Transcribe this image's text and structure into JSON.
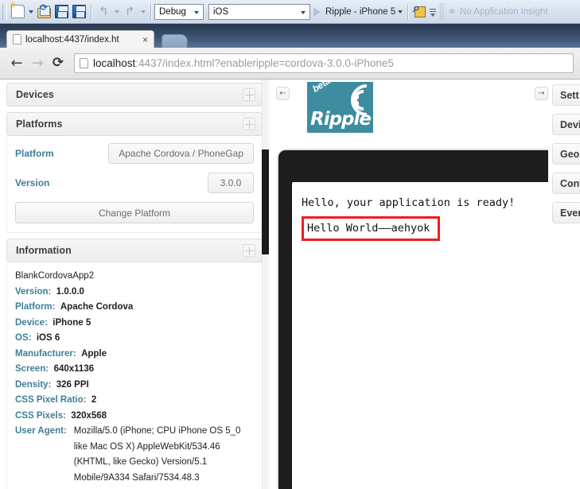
{
  "vs_toolbar": {
    "icons": [
      {
        "name": "new-item-icon",
        "title": "Add New Item"
      },
      {
        "name": "open-file-icon",
        "title": "Open File"
      },
      {
        "name": "save-icon",
        "title": "Save"
      },
      {
        "name": "save-all-icon",
        "title": "Save All"
      },
      {
        "name": "undo-icon",
        "glyph": "↰"
      },
      {
        "name": "redo-icon",
        "glyph": "↱"
      }
    ],
    "config_combo": {
      "value": "Debug"
    },
    "platform_combo": {
      "value": "iOS"
    },
    "run_target": "Ripple - iPhone 5",
    "find_icon": "find-icon",
    "insight_text": "No Application Insight"
  },
  "browser": {
    "tab": {
      "title": "localhost:4437/index.ht",
      "close_label": "×"
    },
    "nav": {
      "back": "←",
      "forward": "→",
      "reload": "⟳"
    },
    "omnibox": {
      "host": "localhost",
      "rest": ":4437/index.html?enableripple=cordova-3.0.0-iPhone5"
    }
  },
  "ripple": {
    "collapse_left_glyph": "←",
    "collapse_right_glyph": "→",
    "logo": {
      "beta": "beta",
      "word": "Ripple"
    },
    "panels": {
      "devices": {
        "title": "Devices"
      },
      "platforms": {
        "title": "Platforms",
        "platform_label": "Platform",
        "platform_value": "Apache Cordova / PhoneGap",
        "version_label": "Version",
        "version_value": "3.0.0",
        "change_button": "Change Platform"
      },
      "information": {
        "title": "Information",
        "app_name": "BlankCordovaApp2",
        "rows": [
          {
            "key": "Version:",
            "value": "1.0.0.0"
          },
          {
            "key": "Platform:",
            "value": "Apache Cordova"
          },
          {
            "key": "Device:",
            "value": "iPhone 5"
          },
          {
            "key": "OS:",
            "value": "iOS 6"
          },
          {
            "key": "Manufacturer:",
            "value": "Apple"
          },
          {
            "key": "Screen:",
            "value": "640x1136"
          },
          {
            "key": "Density:",
            "value": "326 PPI"
          },
          {
            "key": "CSS Pixel Ratio:",
            "value": "2"
          },
          {
            "key": "CSS Pixels:",
            "value": "320x568"
          }
        ],
        "user_agent_key": "User Agent:",
        "user_agent_lines": [
          "Mozilla/5.0 (iPhone; CPU iPhone OS 5_0",
          "like Mac OS X) AppleWebKit/534.46",
          "(KHTML, like Gecko) Version/5.1",
          "Mobile/9A334 Safari/7534.48.3"
        ]
      }
    },
    "right_tabs": [
      {
        "label": "Sett"
      },
      {
        "label": "Devi"
      },
      {
        "label": "Geo"
      },
      {
        "label": "Conf"
      },
      {
        "label": "Even"
      }
    ],
    "app": {
      "ready_text": "Hello, your application is ready!",
      "highlight_text": "Hello World——aehyok",
      "highlight_color": "#f51b1b"
    }
  }
}
